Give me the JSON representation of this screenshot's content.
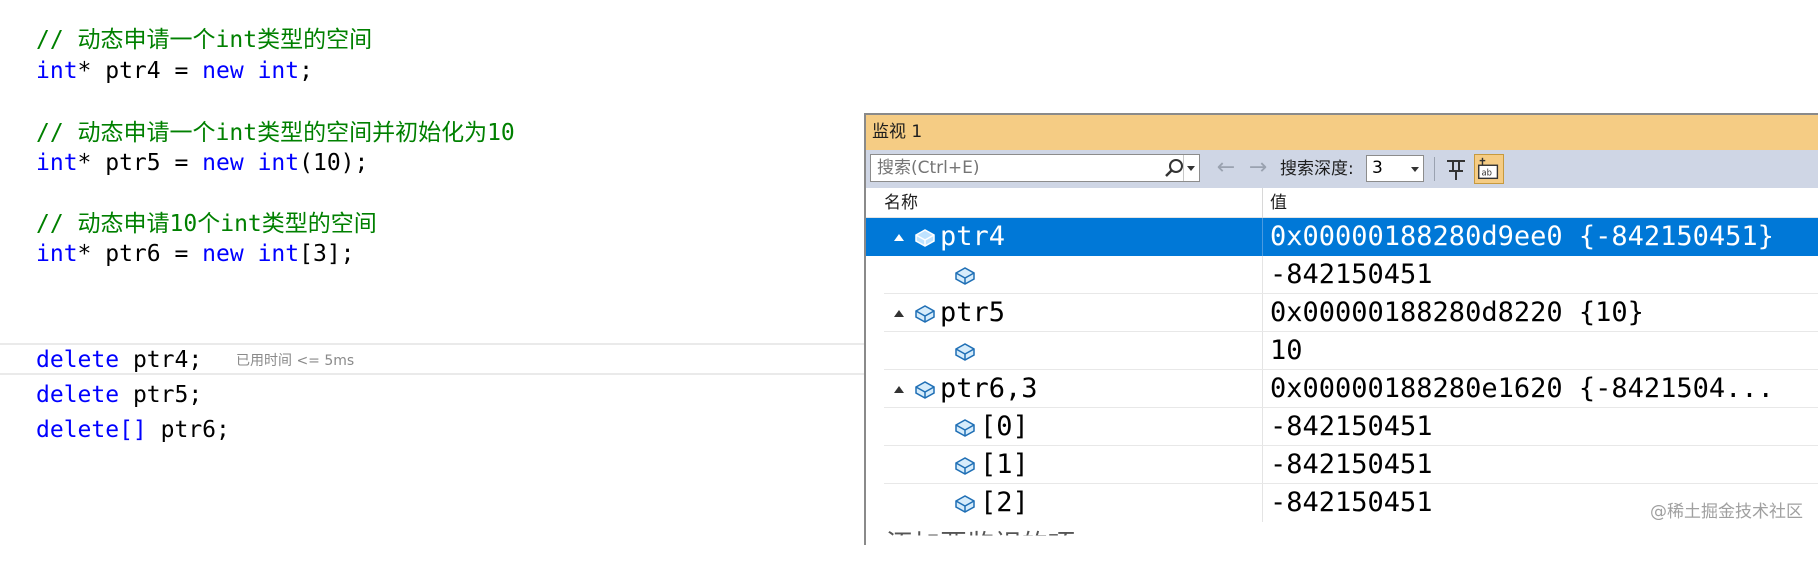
{
  "editor": {
    "line1": {
      "comment": "// 动态申请一个int类型的空间"
    },
    "line2": {
      "kw1": "int",
      "rest1": "* ptr4 = ",
      "kw2": "new",
      "sp": " ",
      "kw3": "int",
      "rest2": ";"
    },
    "line4": {
      "comment": "// 动态申请一个int类型的空间并初始化为10"
    },
    "line5": {
      "kw1": "int",
      "rest1": "* ptr5 = ",
      "kw2": "new",
      "sp": " ",
      "kw3": "int",
      "rest2": "(10);"
    },
    "line7": {
      "comment": "// 动态申请10个int类型的空间"
    },
    "line8": {
      "kw1": "int",
      "rest1": "* ptr6 = ",
      "kw2": "new",
      "sp": " ",
      "kw3": "int",
      "rest2": "[3];"
    },
    "line10": {
      "kw": "delete",
      "rest": " ptr4;"
    },
    "line11": {
      "kw": "delete",
      "rest": " ptr5;"
    },
    "line12": {
      "kw": "delete[]",
      "rest": " ptr6;"
    },
    "perf_tip": "已用时间 <= 5ms"
  },
  "watch": {
    "title": "监视 1",
    "search_placeholder": "搜索(Ctrl+E)",
    "back_arrow": "←",
    "forward_arrow": "→",
    "depth_label": "搜索深度:",
    "depth_value": "3",
    "col_name": "名称",
    "col_value": "值",
    "rows": [
      {
        "name": "ptr4",
        "value": "0x00000188280d9ee0 {-842150451}"
      },
      {
        "name": "",
        "value": "-842150451"
      },
      {
        "name": "ptr5",
        "value": "0x00000188280d8220 {10}"
      },
      {
        "name": "",
        "value": "10"
      },
      {
        "name": "ptr6,3",
        "value": "0x00000188280e1620 {-8421504..."
      },
      {
        "name": "[0]",
        "value": "-842150451"
      },
      {
        "name": "[1]",
        "value": "-842150451"
      },
      {
        "name": "[2]",
        "value": "-842150451"
      }
    ],
    "add_item_hint": "添加要监视的项"
  },
  "watermark": "@稀土掘金技术社区",
  "colors": {
    "comment": "#008000",
    "keyword": "#0000ff",
    "title_bar": "#f5cc84",
    "toolbar": "#cfd6e5",
    "selection": "#0078d7"
  }
}
